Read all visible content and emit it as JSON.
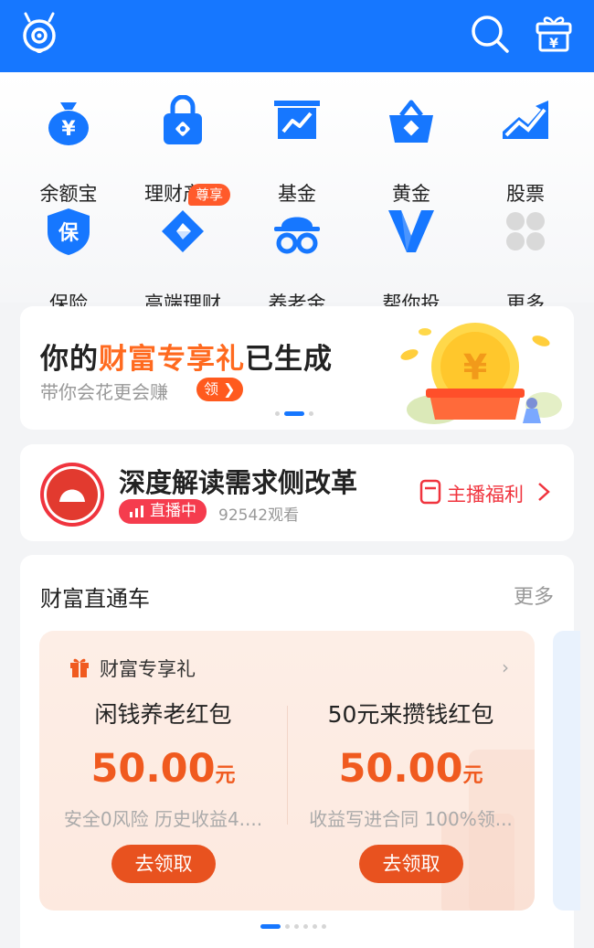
{
  "header": {
    "logo_icon": "mascot-logo-icon",
    "search_icon": "search-icon",
    "gift_icon": "yen-gift-icon"
  },
  "menu": {
    "items": [
      {
        "label": "余额宝",
        "icon": "yen-bag-icon"
      },
      {
        "label": "理财产品",
        "icon": "lock-bag-icon"
      },
      {
        "label": "基金",
        "icon": "fund-chart-icon"
      },
      {
        "label": "黄金",
        "icon": "gold-basket-icon"
      },
      {
        "label": "股票",
        "icon": "stock-trend-icon"
      },
      {
        "label": "保险",
        "icon": "insurance-shield-icon"
      },
      {
        "label": "高端理财",
        "icon": "diamond-icon",
        "badge": "尊享"
      },
      {
        "label": "养老金",
        "icon": "pension-hat-icon"
      },
      {
        "label": "帮你投",
        "icon": "v-logo-icon"
      },
      {
        "label": "更多",
        "icon": "more-grid-icon"
      }
    ]
  },
  "banner": {
    "title_pre": "你的",
    "title_highlight": "财富专享礼",
    "title_post": "已生成",
    "subtitle": "带你会花更会赚",
    "button": "领",
    "colors": {
      "highlight": "#ff6a1f"
    }
  },
  "live": {
    "title": "深度解读需求侧改革",
    "badge": "直播中",
    "views": "92542观看",
    "gift_label": "主播福利"
  },
  "wealth": {
    "title": "财富直通车",
    "more": "更多",
    "card_header": "财富专享礼",
    "offers": [
      {
        "title": "闲钱养老红包",
        "amount": "50.00",
        "unit": "元",
        "desc": "安全0风险 历史收益4....",
        "button": "去领取"
      },
      {
        "title": "50元来攒钱红包",
        "amount": "50.00",
        "unit": "元",
        "desc": "收益写进合同 100%领...",
        "button": "去领取"
      }
    ]
  },
  "colors": {
    "brand_blue": "#1677ff",
    "accent_orange": "#f05a1f",
    "live_red": "#f53c4e"
  }
}
